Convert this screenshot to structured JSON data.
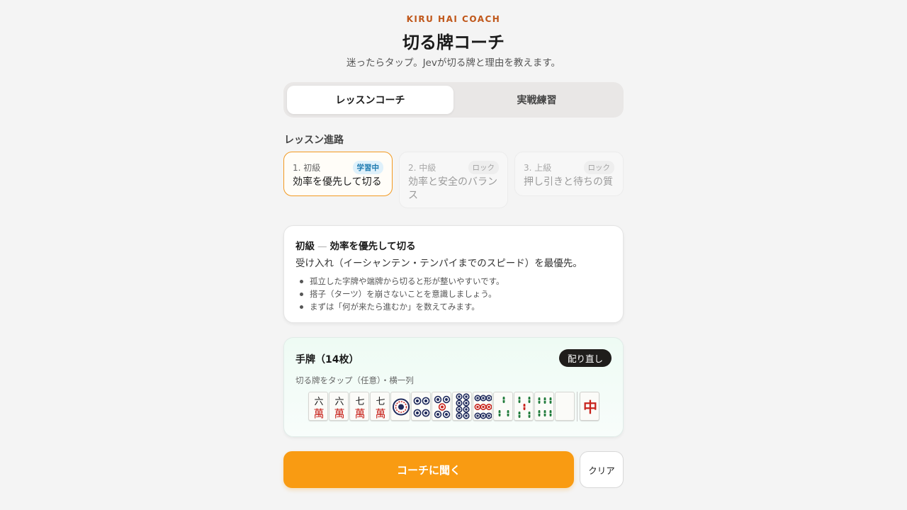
{
  "header": {
    "eyebrow": "KIRU HAI COACH",
    "title": "切る牌コーチ",
    "subtitle": "迷ったらタップ。Jevが切る牌と理由を教えます。"
  },
  "mode_tabs": [
    {
      "label": "レッスンコーチ",
      "active": true
    },
    {
      "label": "実戦練習",
      "active": false
    }
  ],
  "lesson_path": {
    "label": "レッスン進路",
    "steps": [
      {
        "num": "1. 初級",
        "badge": "学習中",
        "name": "効率を優先して切る",
        "state": "current"
      },
      {
        "num": "2. 中級",
        "badge": "ロック",
        "name": "効率と安全のバランス",
        "state": "locked"
      },
      {
        "num": "3. 上級",
        "badge": "ロック",
        "name": "押し引きと待ちの質",
        "state": "locked"
      }
    ]
  },
  "lesson_card": {
    "level": "初級",
    "separator": "—",
    "topic": "効率を優先して切る",
    "description": "受け入れ（イーシャンテン・テンパイまでのスピード）を最優先。",
    "tips": [
      "孤立した字牌や端牌から切ると形が整いやすいです。",
      "搭子（ターツ）を崩さないことを意識しましょう。",
      "まずは「何が来たら進むか」を数えてみます。"
    ]
  },
  "hand": {
    "title": "手牌（14枚）",
    "redeal_label": "配り直し",
    "hint": "切る牌をタップ（任意）・横一列",
    "tiles": [
      {
        "name": "6-man-tile",
        "kind": "man",
        "glyph": "六"
      },
      {
        "name": "6-man-tile",
        "kind": "man",
        "glyph": "六"
      },
      {
        "name": "7-man-tile",
        "kind": "man",
        "glyph": "七"
      },
      {
        "name": "7-man-tile",
        "kind": "man",
        "glyph": "七"
      },
      {
        "name": "1-pin-tile",
        "kind": "pin1"
      },
      {
        "name": "4-pin-tile",
        "kind": "pin4"
      },
      {
        "name": "5-pin-tile",
        "kind": "pin5"
      },
      {
        "name": "8-pin-tile",
        "kind": "pin8"
      },
      {
        "name": "9-pin-tile",
        "kind": "pin9"
      },
      {
        "name": "3-sou-tile",
        "kind": "sou3"
      },
      {
        "name": "5-sou-tile",
        "kind": "sou5"
      },
      {
        "name": "6-sou-tile",
        "kind": "sou6"
      },
      {
        "name": "white-dragon-tile",
        "kind": "blank"
      },
      {
        "name": "red-dragon-tile",
        "kind": "chun",
        "glyph": "中"
      }
    ],
    "colors": {
      "man_red": "#c8241d",
      "man_black": "#1a1a1a",
      "pin_blue": "#1f2a5c",
      "pin_red": "#c8241d",
      "sou_green": "#1f7a3a",
      "sou_red": "#c8241d"
    }
  },
  "actions": {
    "coach_label": "コーチに聞く",
    "clear_label": "クリア"
  },
  "colors": {
    "accent": "#f99b12",
    "eyebrow": "#c0571a",
    "badge_blue": "#1f7bb0"
  }
}
